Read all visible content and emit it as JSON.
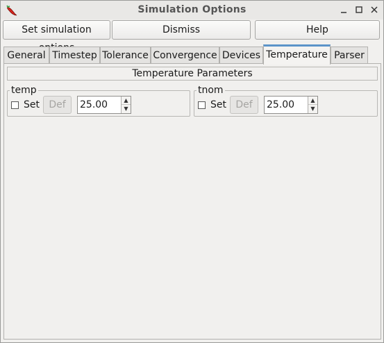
{
  "window": {
    "title": "Simulation Options",
    "controls": {
      "minimize": "_",
      "maximize": "□",
      "close": "×"
    }
  },
  "toolbar": {
    "set_label": "Set simulation options",
    "dismiss_label": "Dismiss",
    "help_label": "Help"
  },
  "tabs": [
    {
      "label": "General"
    },
    {
      "label": "Timestep"
    },
    {
      "label": "Tolerance"
    },
    {
      "label": "Convergence"
    },
    {
      "label": "Devices"
    },
    {
      "label": "Temperature",
      "active": true
    },
    {
      "label": "Parser"
    }
  ],
  "panel": {
    "title": "Temperature Parameters",
    "params": [
      {
        "name": "temp",
        "set_label": "Set",
        "checked": false,
        "def_label": "Def",
        "value": "25.00"
      },
      {
        "name": "tnom",
        "set_label": "Set",
        "checked": false,
        "def_label": "Def",
        "value": "25.00"
      }
    ]
  },
  "spin": {
    "up_glyph": "▲",
    "down_glyph": "▼"
  },
  "colors": {
    "active_tab_accent": "#5b93c9",
    "icon_red": "#d8251c",
    "icon_green": "#3aa64a"
  }
}
